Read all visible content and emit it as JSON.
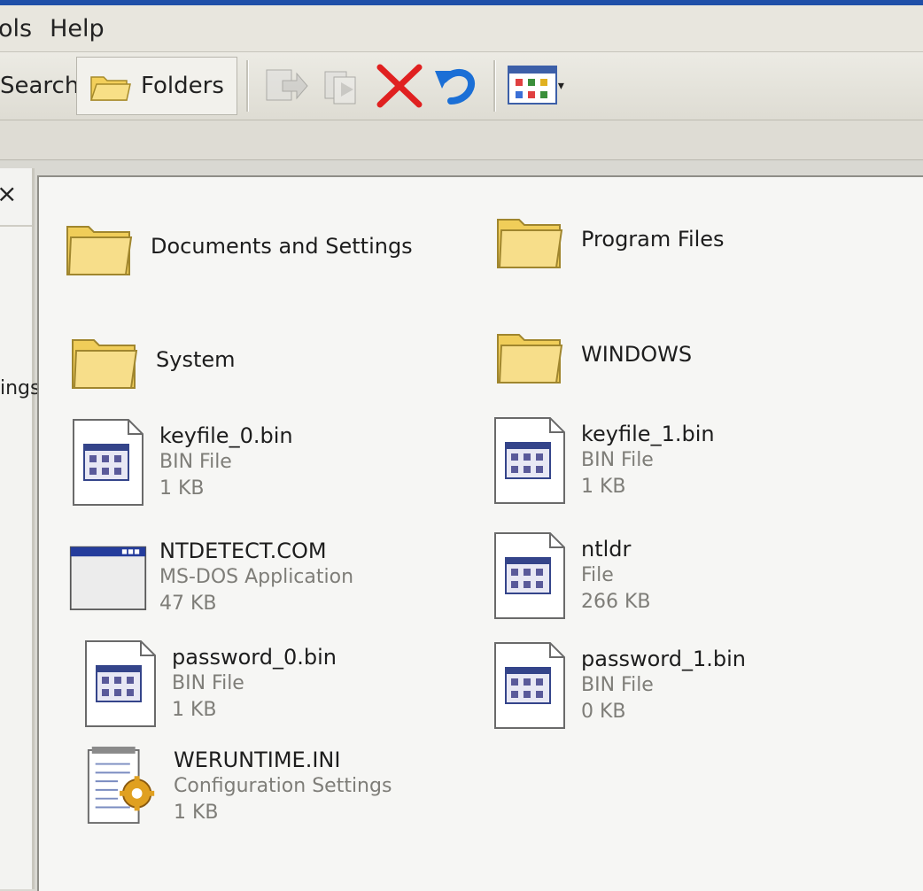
{
  "menu": {
    "items": [
      "ols",
      "Help"
    ]
  },
  "toolbar": {
    "search_label": "Search",
    "folders_label": "Folders"
  },
  "left_pane": {
    "close": "×",
    "partial_text": "ings"
  },
  "folders": [
    {
      "name": "Documents and Settings"
    },
    {
      "name": "Program Files"
    },
    {
      "name": "System"
    },
    {
      "name": "WINDOWS"
    }
  ],
  "files": [
    {
      "name": "keyfile_0.bin",
      "type": "BIN File",
      "size": "1 KB",
      "icon": "bin-file-icon"
    },
    {
      "name": "keyfile_1.bin",
      "type": "BIN File",
      "size": "1 KB",
      "icon": "bin-file-icon"
    },
    {
      "name": "NTDETECT.COM",
      "type": "MS-DOS Application",
      "size": "47 KB",
      "icon": "ms-dos-app-icon"
    },
    {
      "name": "ntldr",
      "type": "File",
      "size": "266 KB",
      "icon": "bin-file-icon"
    },
    {
      "name": "password_0.bin",
      "type": "BIN File",
      "size": "1 KB",
      "icon": "bin-file-icon"
    },
    {
      "name": "password_1.bin",
      "type": "BIN File",
      "size": "0 KB",
      "icon": "bin-file-icon"
    },
    {
      "name": "WERUNTIME.INI",
      "type": "Configuration Settings",
      "size": "1 KB",
      "icon": "config-file-icon"
    }
  ],
  "colors": {
    "folder": "#f5d66a",
    "selection": "#1f4fa8",
    "delete": "#e02020",
    "undo": "#1b6fd6"
  }
}
